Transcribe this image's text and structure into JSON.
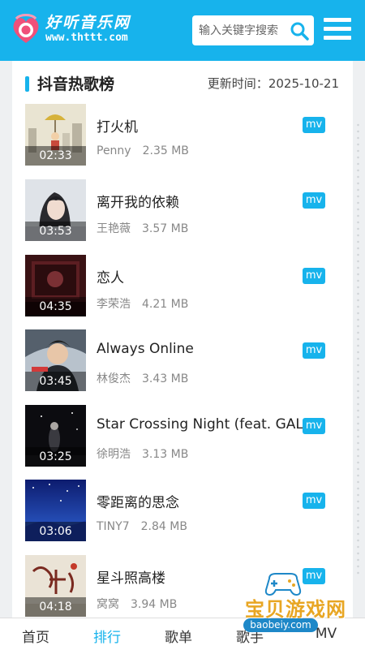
{
  "header": {
    "logo_text": "好听音乐网",
    "logo_url": "www.thttt.com",
    "search_placeholder": "输入关键字搜索",
    "colors": {
      "brand": "#17b3ec"
    }
  },
  "section": {
    "title": "抖音热歌榜",
    "update_label": "更新时间：",
    "update_date": "2025-10-21"
  },
  "songs": [
    {
      "title": "打火机",
      "artist": "Penny",
      "size": "2.35 MB",
      "duration": "02:33",
      "badge": "mv"
    },
    {
      "title": "离开我的依赖",
      "artist": "王艳薇",
      "size": "3.57 MB",
      "duration": "03:53",
      "badge": "mv"
    },
    {
      "title": "恋人",
      "artist": "李荣浩",
      "size": "4.21 MB",
      "duration": "04:35",
      "badge": "mv"
    },
    {
      "title": "Always Online",
      "artist": "林俊杰",
      "size": "3.43 MB",
      "duration": "03:45",
      "badge": "mv"
    },
    {
      "title": "Star Crossing Night (feat. GALI)",
      "artist": "徐明浩",
      "size": "3.13 MB",
      "duration": "03:25",
      "badge": "mv"
    },
    {
      "title": "零距离的思念",
      "artist": "TINY7",
      "size": "2.84 MB",
      "duration": "03:06",
      "badge": "mv"
    },
    {
      "title": "星斗照高楼",
      "artist": "窝窝",
      "size": "3.94 MB",
      "duration": "04:18",
      "badge": "mv"
    }
  ],
  "nav": {
    "home": "首页",
    "ranking": "排行",
    "playlist": "歌单",
    "singer": "歌手",
    "mv": "MV",
    "active": "ranking"
  },
  "watermark": {
    "text": "宝贝游戏网",
    "url": "baobeiy.com"
  }
}
